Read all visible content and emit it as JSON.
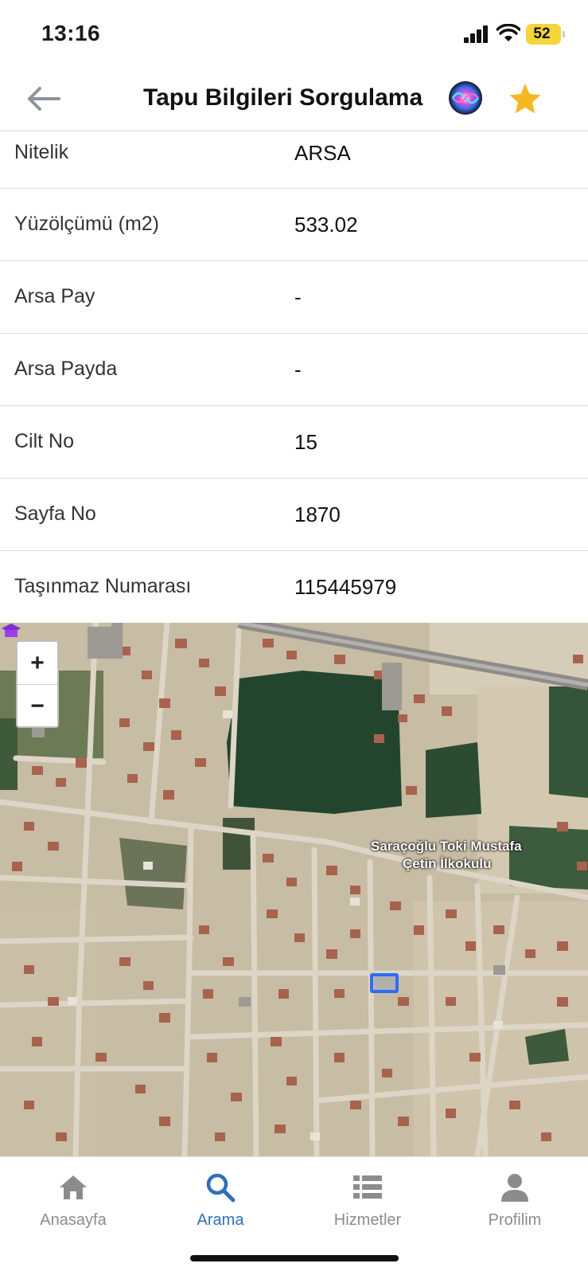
{
  "status_bar": {
    "time": "13:16",
    "battery": "52"
  },
  "header": {
    "title": "Tapu Bilgileri Sorgulama"
  },
  "info_rows": [
    {
      "label": "Nitelik",
      "value": "ARSA"
    },
    {
      "label": "Yüzölçümü (m2)",
      "value": "533.02"
    },
    {
      "label": "Arsa Pay",
      "value": "-"
    },
    {
      "label": "Arsa Payda",
      "value": "-"
    },
    {
      "label": "Cilt No",
      "value": "15"
    },
    {
      "label": "Sayfa No",
      "value": "1870"
    },
    {
      "label": "Taşınmaz Numarası",
      "value": "115445979"
    }
  ],
  "map": {
    "zoom_in": "+",
    "zoom_out": "−",
    "poi_line1": "Saraçoğlu Toki Mustafa",
    "poi_line2": "Çetin İlkokulu"
  },
  "nav": [
    {
      "label": "Anasayfa",
      "icon": "home-icon"
    },
    {
      "label": "Arama",
      "icon": "search-icon",
      "active": true
    },
    {
      "label": "Hizmetler",
      "icon": "list-icon"
    },
    {
      "label": "Profilim",
      "icon": "profile-icon"
    }
  ],
  "colors": {
    "accent": "#2f6fb6",
    "star": "#f5b820",
    "battery": "#f4d53b",
    "parcel": "#2f6cf5"
  }
}
